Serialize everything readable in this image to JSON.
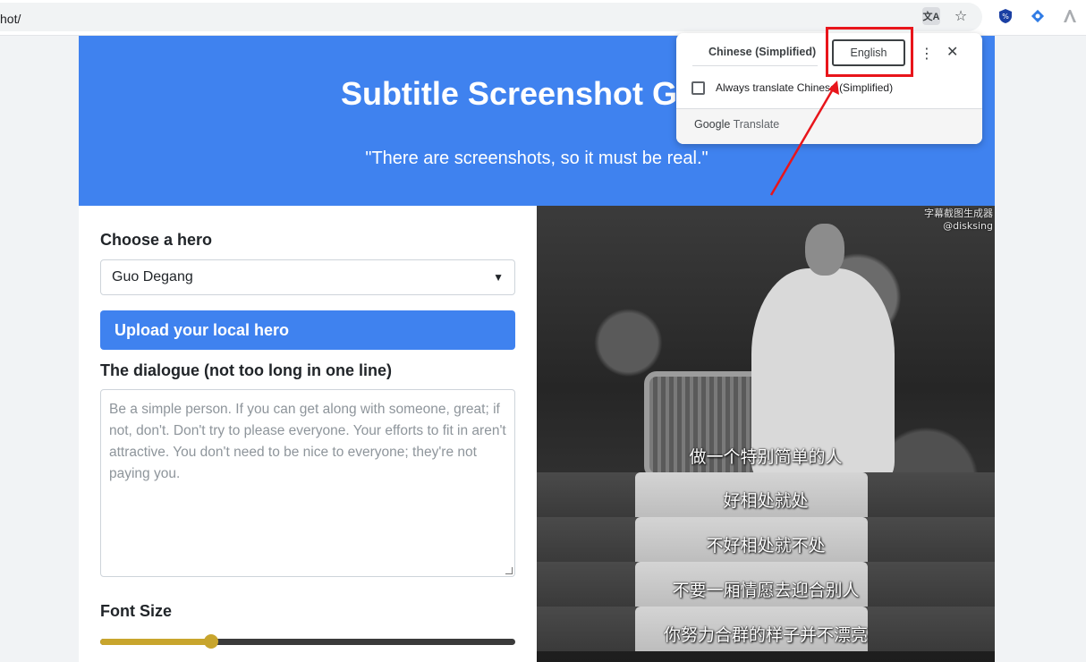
{
  "browser": {
    "url": "hot/",
    "icons": [
      "translate-icon",
      "star-icon",
      "extension-shield-icon",
      "extension-diamond-icon",
      "extension-logo-icon"
    ]
  },
  "header": {
    "title": "Subtitle Screenshot Gene",
    "subtitle": "\"There are screenshots, so it must be real.\""
  },
  "form": {
    "hero_label": "Choose a hero",
    "hero_selected": "Guo Degang",
    "upload_label": "Upload your local hero",
    "dialogue_label": "The dialogue (not too long in one line)",
    "dialogue_placeholder": "Be a simple person. If you can get along with someone, great; if not, don't. Don't try to please everyone. Your efforts to fit in aren't attractive. You don't need to be nice to everyone; they're not paying you.",
    "font_size_label": "Font Size",
    "font_size_fraction": 0.26
  },
  "preview": {
    "watermark_line1": "字幕截图生成器",
    "watermark_line2": "@disksing",
    "captions": [
      "做一个特别简单的人",
      "好相处就处",
      "不好相处就不处",
      "不要一厢情愿去迎合别人",
      "你努力合群的样子并不漂亮"
    ]
  },
  "translate_popup": {
    "source_lang": "Chinese (Simplified)",
    "target_lang": "English",
    "always_translate": "Always translate Chinese (Simplified)",
    "footer_google": "Google",
    "footer_translate": "Translate"
  },
  "colors": {
    "accent": "#3f82ef",
    "slider": "#c8a52d",
    "highlight": "#e8151b"
  }
}
